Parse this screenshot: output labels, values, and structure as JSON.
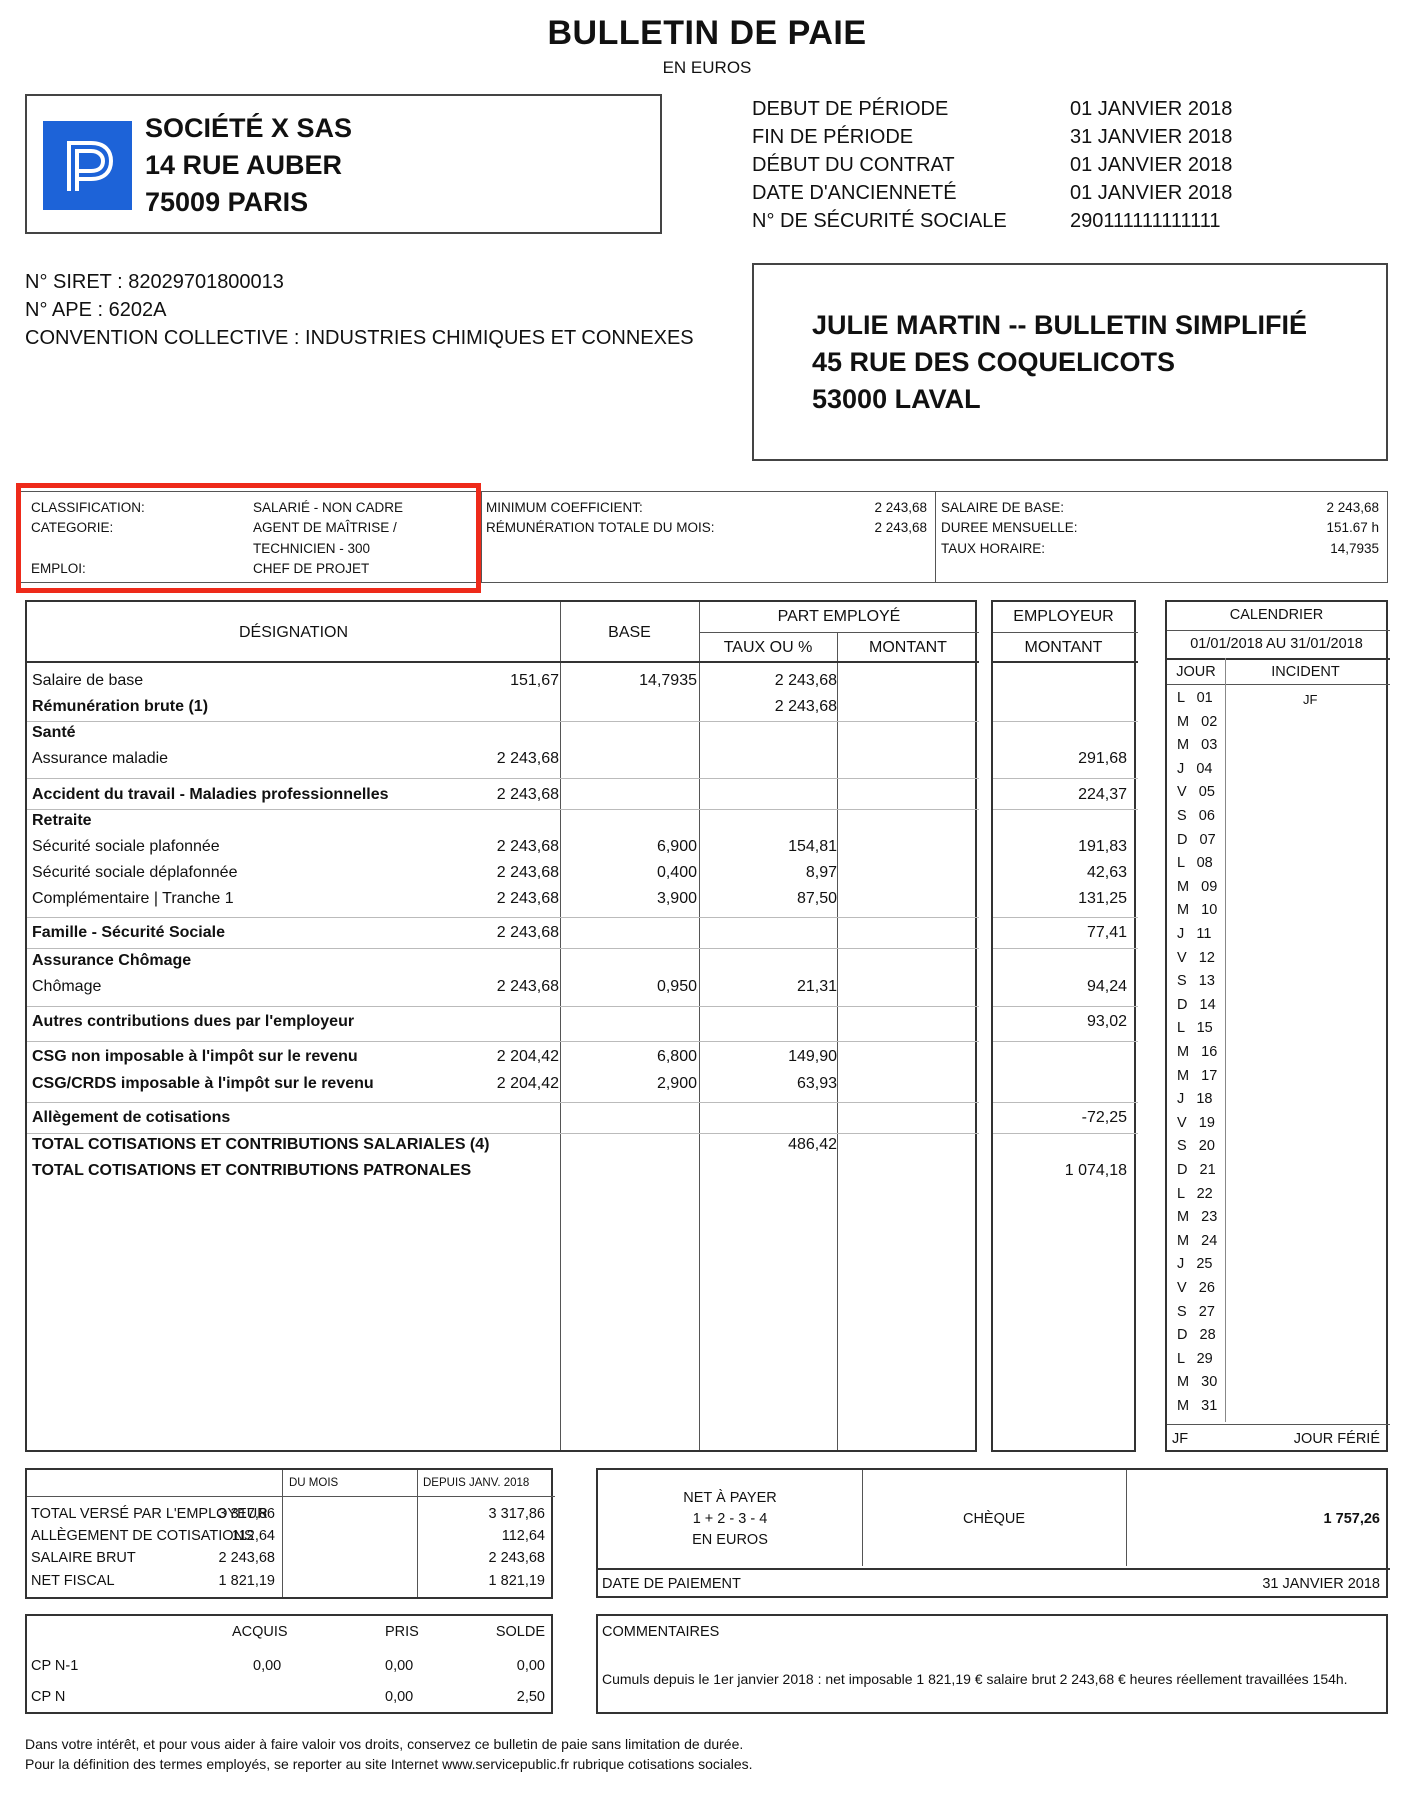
{
  "header": {
    "title": "BULLETIN DE PAIE",
    "subtitle": "EN EUROS"
  },
  "company": {
    "logo_letter": "P",
    "name": "SOCIÉTÉ X SAS",
    "address1": "14 RUE AUBER",
    "address2": "75009 PARIS",
    "logo_color": "#1d63d8"
  },
  "period": [
    {
      "label": "DEBUT DE PÉRIODE",
      "value": "01 JANVIER 2018"
    },
    {
      "label": "FIN DE PÉRIODE",
      "value": "31 JANVIER 2018"
    },
    {
      "label": "DÉBUT DU CONTRAT",
      "value": "01 JANVIER 2018"
    },
    {
      "label": "DATE D'ANCIENNETÉ",
      "value": "01 JANVIER 2018"
    },
    {
      "label": "N° DE SÉCURITÉ SOCIALE",
      "value": "290111111111111"
    }
  ],
  "legal": {
    "siret": "N° SIRET : 82029701800013",
    "ape": "N° APE : 6202A",
    "convention": "CONVENTION COLLECTIVE : INDUSTRIES CHIMIQUES ET CONNEXES"
  },
  "employee": {
    "line1": "JULIE MARTIN -- BULLETIN SIMPLIFIÉ",
    "line2": "45 RUE DES COQUELICOTS",
    "line3": "53000 LAVAL"
  },
  "info": {
    "classification_label": "CLASSIFICATION:",
    "classification_value": "SALARIÉ - NON CADRE",
    "categorie_label": "CATEGORIE:",
    "categorie_value1": "AGENT DE MAÎTRISE /",
    "categorie_value2": "TECHNICIEN - 300",
    "emploi_label": "EMPLOI:",
    "emploi_value": "CHEF DE PROJET",
    "min_coef_label": "MINIMUM COEFFICIENT:",
    "min_coef_value": "2 243,68",
    "rem_label": "RÉMUNÉRATION TOTALE DU MOIS:",
    "rem_value": "2 243,68",
    "salaire_base_label": "SALAIRE DE BASE:",
    "salaire_base_value": "2 243,68",
    "duree_label": "DUREE MENSUELLE:",
    "duree_value": "151.67 h",
    "taux_label": "TAUX HORAIRE:",
    "taux_value": "14,7935",
    "highlight_color": "#ee2a1a"
  },
  "table_headers": {
    "designation": "DÉSIGNATION",
    "base": "BASE",
    "part_employe": "PART EMPLOYÉ",
    "taux": "TAUX OU %",
    "montant": "MONTANT",
    "employeur": "EMPLOYEUR",
    "employeur_montant": "MONTANT"
  },
  "rows": [
    {
      "des": "Salaire de base",
      "base": "151,67",
      "taux": "14,7935",
      "mont": "2 243,68",
      "emp": ""
    },
    {
      "des": "Rémunération brute (1)",
      "base": "",
      "taux": "",
      "mont": "2 243,68",
      "emp": ""
    },
    {
      "des": "Santé",
      "base": "",
      "taux": "",
      "mont": "",
      "emp": ""
    },
    {
      "des": "Assurance maladie",
      "base": "2 243,68",
      "taux": "",
      "mont": "",
      "emp": "291,68"
    },
    {
      "des": "Accident du travail - Maladies professionnelles",
      "base": "2 243,68",
      "taux": "",
      "mont": "",
      "emp": "224,37"
    },
    {
      "des": "Retraite",
      "base": "",
      "taux": "",
      "mont": "",
      "emp": ""
    },
    {
      "des": "Sécurité sociale plafonnée",
      "base": "2 243,68",
      "taux": "6,900",
      "mont": "154,81",
      "emp": "191,83"
    },
    {
      "des": "Sécurité sociale déplafonnée",
      "base": "2 243,68",
      "taux": "0,400",
      "mont": "8,97",
      "emp": "42,63"
    },
    {
      "des": "Complémentaire | Tranche 1",
      "base": "2 243,68",
      "taux": "3,900",
      "mont": "87,50",
      "emp": "131,25"
    },
    {
      "des": "Famille - Sécurité Sociale",
      "base": "2 243,68",
      "taux": "",
      "mont": "",
      "emp": "77,41"
    },
    {
      "des": "Assurance Chômage",
      "base": "",
      "taux": "",
      "mont": "",
      "emp": ""
    },
    {
      "des": "Chômage",
      "base": "2 243,68",
      "taux": "0,950",
      "mont": "21,31",
      "emp": "94,24"
    },
    {
      "des": "Autres contributions dues par l'employeur",
      "base": "",
      "taux": "",
      "mont": "",
      "emp": "93,02"
    },
    {
      "des": "CSG non imposable à l'impôt sur le revenu",
      "base": "2 204,42",
      "taux": "6,800",
      "mont": "149,90",
      "emp": ""
    },
    {
      "des": "CSG/CRDS imposable à l'impôt sur le revenu",
      "base": "2 204,42",
      "taux": "2,900",
      "mont": "63,93",
      "emp": ""
    },
    {
      "des": "Allègement de cotisations",
      "base": "",
      "taux": "",
      "mont": "",
      "emp": "-72,25"
    },
    {
      "des": "TOTAL COTISATIONS ET CONTRIBUTIONS SALARIALES (4)",
      "base": "",
      "taux": "",
      "mont": "486,42",
      "emp": ""
    },
    {
      "des": "TOTAL COTISATIONS ET CONTRIBUTIONS PATRONALES",
      "base": "",
      "taux": "",
      "mont": "",
      "emp": "1 074,18"
    }
  ],
  "calendar": {
    "title": "CALENDRIER",
    "period": "01/01/2018 AU 31/01/2018",
    "col_jour": "JOUR",
    "col_incident": "INCIDENT",
    "incident_first": "JF",
    "legend_code": "JF",
    "legend_text": "JOUR FÉRIÉ",
    "days": [
      "L 01",
      "M 02",
      "M 03",
      "J 04",
      "V 05",
      "S 06",
      "D 07",
      "L 08",
      "M 09",
      "M 10",
      "J 11",
      "V 12",
      "S 13",
      "D 14",
      "L 15",
      "M 16",
      "M 17",
      "J 18",
      "V 19",
      "S 20",
      "D 21",
      "L 22",
      "M 23",
      "M 24",
      "J 25",
      "V 26",
      "S 27",
      "D 28",
      "L 29",
      "M 30",
      "M 31"
    ]
  },
  "totals": {
    "col_mois": "DU MOIS",
    "col_depuis": "DEPUIS JANV. 2018",
    "rows": [
      {
        "label": "TOTAL VERSÉ PAR L'EMPLOYEUR",
        "mois": "3 317,86",
        "depuis": "3 317,86"
      },
      {
        "label": "ALLÈGEMENT DE COTISATIONS",
        "mois": "112,64",
        "depuis": "112,64"
      },
      {
        "label": "SALAIRE BRUT",
        "mois": "2 243,68",
        "depuis": "2 243,68"
      },
      {
        "label": "NET FISCAL",
        "mois": "1 821,19",
        "depuis": "1 821,19"
      }
    ]
  },
  "conges": {
    "col_acquis": "ACQUIS",
    "col_pris": "PRIS",
    "col_solde": "SOLDE",
    "rows": [
      {
        "label": "CP N-1",
        "acquis": "0,00",
        "pris": "0,00",
        "solde": "0,00"
      },
      {
        "label": "CP N",
        "acquis": "",
        "pris": "0,00",
        "solde": "2,50"
      }
    ]
  },
  "net": {
    "label1": "NET À PAYER",
    "label2": "1 + 2 - 3 - 4",
    "label3": "EN EUROS",
    "method": "CHÈQUE",
    "amount": "1 757,26",
    "date_label": "DATE DE PAIEMENT",
    "date_value": "31 JANVIER 2018"
  },
  "comments": {
    "title": "COMMENTAIRES",
    "text": "Cumuls depuis le 1er janvier 2018 : net imposable 1 821,19 € salaire brut 2 243,68 € heures réellement travaillées 154h."
  },
  "footer": {
    "line1": "Dans votre intérêt, et pour vous aider à faire valoir vos droits, conservez ce bulletin de paie sans limitation de durée.",
    "line2": "Pour la définition des termes employés, se reporter au site Internet www.servicepublic.fr rubrique cotisations sociales."
  }
}
